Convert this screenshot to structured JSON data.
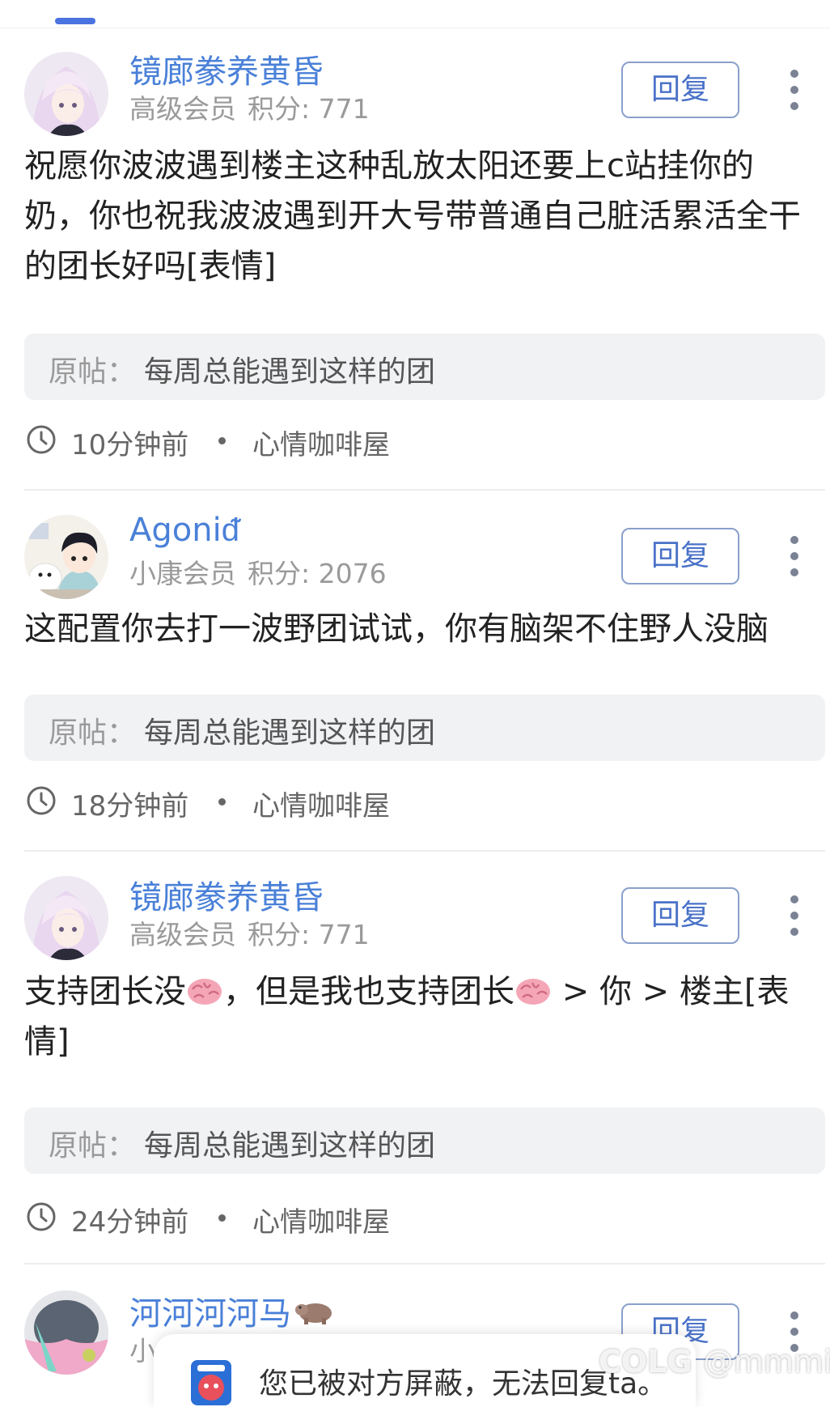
{
  "posts": [
    {
      "username": "镜廊豢养黄昏",
      "level": "高级会员",
      "points_label": "积分: 771",
      "reply_label": "回复",
      "content": "祝愿你波波遇到楼主这种乱放太阳还要上c站挂你的奶，你也祝我波波遇到开大号带普通自己脏活累活全干的团长好吗[表情]",
      "quote_label": "原帖：",
      "quote_text": "每周总能遇到这样的团",
      "time": "10分钟前",
      "category": "心情咖啡屋"
    },
    {
      "username": "Agoniᵭ",
      "level": "小康会员",
      "points_label": "积分: 2076",
      "reply_label": "回复",
      "content": "这配置你去打一波野团试试，你有脑架不住野人没脑",
      "quote_label": "原帖：",
      "quote_text": "每周总能遇到这样的团",
      "time": "18分钟前",
      "category": "心情咖啡屋"
    },
    {
      "username": "镜廊豢养黄昏",
      "level": "高级会员",
      "points_label": "积分: 771",
      "reply_label": "回复",
      "content_parts": [
        "支持团长没",
        "，但是我也支持团长",
        " > 你 > 楼主[表情]"
      ],
      "quote_label": "原帖：",
      "quote_text": "每周总能遇到这样的团",
      "time": "24分钟前",
      "category": "心情咖啡屋"
    },
    {
      "username": "河河河河马",
      "level": "小",
      "reply_label": "回复"
    }
  ],
  "toast": {
    "message": "您已被对方屏蔽，无法回复ta。"
  },
  "watermark": {
    "logo": "COLG",
    "handle": "@mmmio"
  },
  "colors": {
    "accent": "#4a72e0",
    "username": "#4a80d8",
    "quote_bg": "#f1f2f4"
  }
}
